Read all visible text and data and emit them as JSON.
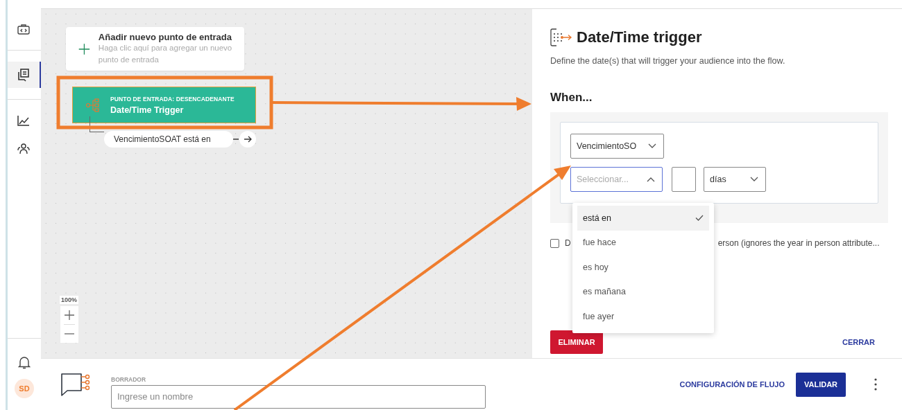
{
  "sidebar": {
    "items": [
      {
        "selected": false
      },
      {
        "selected": true
      },
      {
        "selected": false
      },
      {
        "selected": false
      }
    ],
    "avatar": "SD"
  },
  "canvas": {
    "add_entry": {
      "title": "Añadir nuevo punto de entrada",
      "subtitle": "Haga clic aquí para agregar un nuevo punto de entrada"
    },
    "node": {
      "label": "PUNTO DE ENTRADA: DESENCADENANTE",
      "title": "Date/Time Trigger",
      "selected": true
    },
    "branch": {
      "label": "VencimientoSOAT está en"
    },
    "zoom": {
      "level_text": "100%"
    }
  },
  "panel": {
    "title": "Date/Time trigger",
    "description": "Define the date(s) that will trigger your audience into the flow.",
    "section": "When...",
    "attribute_select": {
      "value": "VencimientoSO"
    },
    "operator_select": {
      "placeholder": "Seleccionar...",
      "expanded": true
    },
    "unit_select": {
      "value": "días"
    },
    "options": [
      {
        "label": "está en",
        "selected": true
      },
      {
        "label": "fue hace",
        "selected": false
      },
      {
        "label": "es hoy",
        "selected": false
      },
      {
        "label": "es mañana",
        "selected": false
      },
      {
        "label": "fue ayer",
        "selected": false
      }
    ],
    "recurring": {
      "checked": false,
      "label_start": "D",
      "label_end": "erson (ignores the year in person attribute..."
    },
    "delete_button": "ELIMINAR",
    "close_button": "CERRAR"
  },
  "footer": {
    "status": "BORRADOR",
    "name_field": {
      "placeholder": "Ingrese un nombre"
    },
    "settings_link": "CONFIGURACIÓN DE FLUJO",
    "validate_button": "VALIDAR"
  }
}
